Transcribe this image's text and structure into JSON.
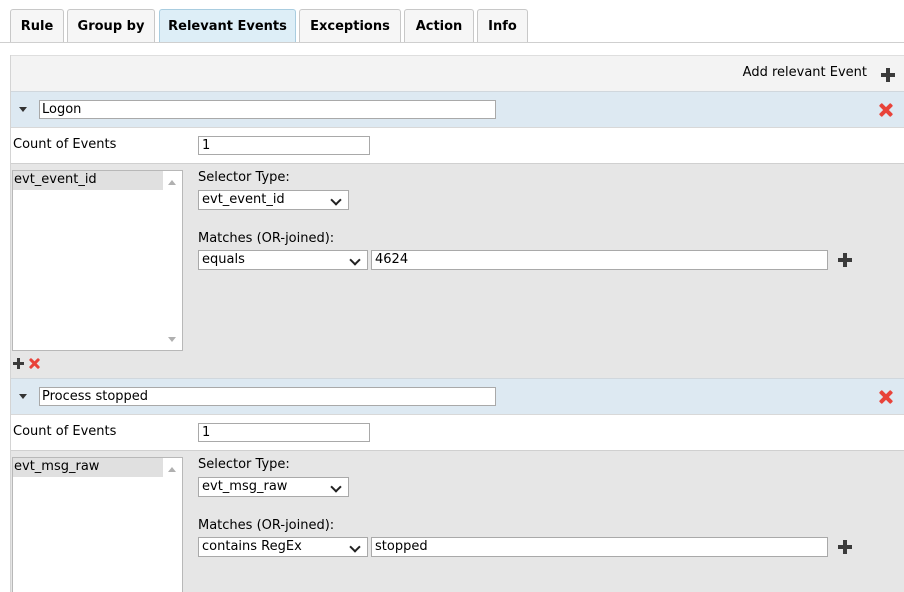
{
  "tabs": [
    {
      "label": "Rule",
      "active": false
    },
    {
      "label": "Group by",
      "active": false
    },
    {
      "label": "Relevant Events",
      "active": true
    },
    {
      "label": "Exceptions",
      "active": false
    },
    {
      "label": "Action",
      "active": false
    },
    {
      "label": "Info",
      "active": false
    }
  ],
  "add_event_label": "Add relevant Event",
  "events": [
    {
      "name": "Logon",
      "count_label": "Count of Events",
      "count_value": "1",
      "selector_list": [
        "evt_event_id"
      ],
      "selector_type_label": "Selector Type:",
      "selector_type_value": "evt_event_id",
      "matches_label": "Matches (OR-joined):",
      "match_operator": "equals",
      "match_value": "4624"
    },
    {
      "name": "Process stopped",
      "count_label": "Count of Events",
      "count_value": "1",
      "selector_list": [
        "evt_msg_raw"
      ],
      "selector_type_label": "Selector Type:",
      "selector_type_value": "evt_msg_raw",
      "matches_label": "Matches (OR-joined):",
      "match_operator": "contains RegEx",
      "match_value": "stopped"
    }
  ],
  "colors": {
    "active_tab": "#ddeef7",
    "event_header": "#dde9f2",
    "delete_red": "#e8433a",
    "add_dark": "#3b3b3b",
    "selector_bg": "#e6e6e6"
  }
}
